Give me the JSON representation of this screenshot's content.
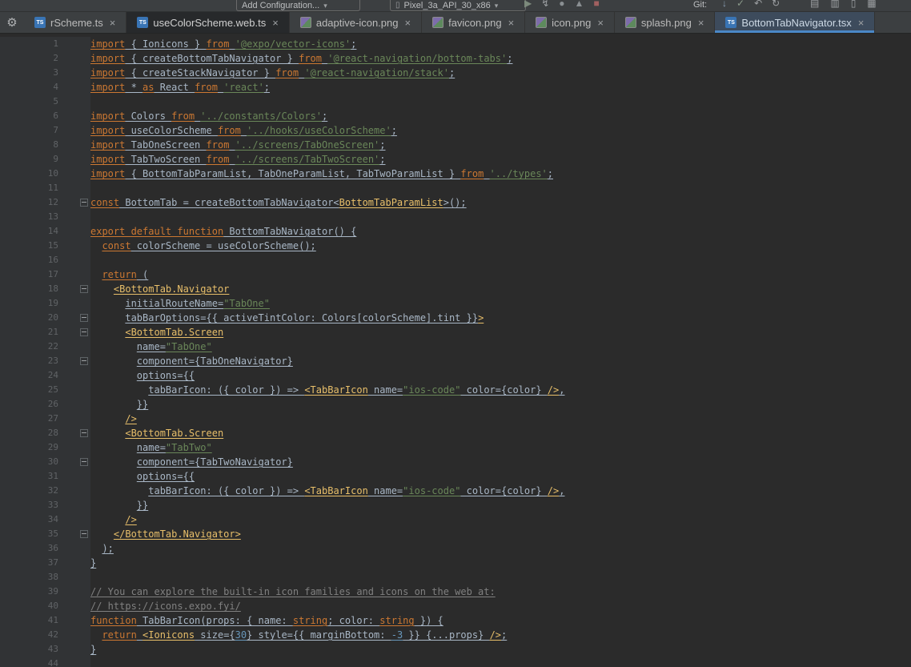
{
  "colors": {
    "editor_background": "#2b2b2b",
    "gutter_background": "#313335",
    "toolbar_background": "#3c3f41",
    "active_tab_underline": "#4a88c7",
    "keyword": "#cc7832",
    "string": "#6a8759",
    "jsx_tag": "#e8bf6a",
    "number": "#6897bb",
    "comment": "#808080",
    "plain_text": "#a9b7c6",
    "line_number": "#606366"
  },
  "toolbar": {
    "add_configuration": "Add Configuration...",
    "device": "Pixel_3a_API_30_x86",
    "git_label": "Git:",
    "caret_glyph": "▾",
    "device_icon_glyph": "▯",
    "run_icons": [
      {
        "name": "run-icon",
        "glyph": "▶",
        "color": "#7c8a7c"
      },
      {
        "name": "apply-changes-icon",
        "glyph": "↯",
        "color": "#9da0a3"
      },
      {
        "name": "debug-icon",
        "glyph": "●",
        "color": "#8a8f92"
      },
      {
        "name": "profiler-icon",
        "glyph": "▲",
        "color": "#8a8f92"
      },
      {
        "name": "stop-icon",
        "glyph": "■",
        "color": "#a06060"
      }
    ],
    "git_icons": [
      {
        "name": "update-project-icon",
        "glyph": "↓",
        "color": "#8a9fb5"
      },
      {
        "name": "commit-icon",
        "glyph": "✓",
        "color": "#8a9a8a"
      },
      {
        "name": "rollback-icon",
        "glyph": "↶",
        "color": "#9da0a3"
      },
      {
        "name": "history-icon",
        "glyph": "↻",
        "color": "#9da0a3"
      }
    ],
    "right_icons": [
      {
        "name": "device-manager-icon",
        "glyph": "▤",
        "color": "#9da0a3"
      },
      {
        "name": "logcat-icon",
        "glyph": "▥",
        "color": "#9da0a3"
      },
      {
        "name": "emulator-icon",
        "glyph": "▯",
        "color": "#9da0a3"
      },
      {
        "name": "sdk-manager-icon",
        "glyph": "▦",
        "color": "#9da0a3"
      }
    ]
  },
  "tabbar": {
    "gear_glyph": "⚙"
  },
  "tabs": {
    "close_glyph": "×",
    "items": [
      {
        "label": "rScheme.ts",
        "type": "ts",
        "state": ""
      },
      {
        "label": "useColorScheme.web.ts",
        "type": "ts",
        "state": "current-dark"
      },
      {
        "label": "adaptive-icon.png",
        "type": "png",
        "state": ""
      },
      {
        "label": "favicon.png",
        "type": "png",
        "state": ""
      },
      {
        "label": "icon.png",
        "type": "png",
        "state": ""
      },
      {
        "label": "splash.png",
        "type": "png",
        "state": ""
      },
      {
        "label": "BottomTabNavigator.tsx",
        "type": "tsx",
        "state": "active"
      }
    ]
  },
  "editor": {
    "fold_lines": [
      12,
      18,
      20,
      21,
      23,
      28,
      30,
      35
    ],
    "lines": [
      [
        [
          "k",
          "import"
        ],
        [
          "p",
          " { Ionicons } "
        ],
        [
          "k",
          "from"
        ],
        [
          "p",
          " "
        ],
        [
          "s",
          "'@expo/vector-icons'"
        ],
        [
          "p",
          ";"
        ]
      ],
      [
        [
          "k",
          "import"
        ],
        [
          "p",
          " { createBottomTabNavigator } "
        ],
        [
          "k",
          "from"
        ],
        [
          "p",
          " "
        ],
        [
          "s",
          "'@react-navigation/bottom-tabs'"
        ],
        [
          "p",
          ";"
        ]
      ],
      [
        [
          "k",
          "import"
        ],
        [
          "p",
          " { createStackNavigator } "
        ],
        [
          "k",
          "from"
        ],
        [
          "p",
          " "
        ],
        [
          "s",
          "'@react-navigation/stack'"
        ],
        [
          "p",
          ";"
        ]
      ],
      [
        [
          "k",
          "import"
        ],
        [
          "p",
          " * "
        ],
        [
          "k",
          "as"
        ],
        [
          "p",
          " React "
        ],
        [
          "k",
          "from"
        ],
        [
          "p",
          " "
        ],
        [
          "s",
          "'react'"
        ],
        [
          "p",
          ";"
        ]
      ],
      [],
      [
        [
          "k",
          "import"
        ],
        [
          "p",
          " Colors "
        ],
        [
          "k",
          "from"
        ],
        [
          "p",
          " "
        ],
        [
          "s",
          "'../constants/Colors'"
        ],
        [
          "p",
          ";"
        ]
      ],
      [
        [
          "k",
          "import"
        ],
        [
          "p",
          " useColorScheme "
        ],
        [
          "k",
          "from"
        ],
        [
          "p",
          " "
        ],
        [
          "s",
          "'../hooks/useColorScheme'"
        ],
        [
          "p",
          ";"
        ]
      ],
      [
        [
          "k",
          "import"
        ],
        [
          "p",
          " TabOneScreen "
        ],
        [
          "k",
          "from"
        ],
        [
          "p",
          " "
        ],
        [
          "s",
          "'../screens/TabOneScreen'"
        ],
        [
          "p",
          ";"
        ]
      ],
      [
        [
          "k",
          "import"
        ],
        [
          "p",
          " TabTwoScreen "
        ],
        [
          "k",
          "from"
        ],
        [
          "p",
          " "
        ],
        [
          "s",
          "'../screens/TabTwoScreen'"
        ],
        [
          "p",
          ";"
        ]
      ],
      [
        [
          "k",
          "import"
        ],
        [
          "p",
          " { BottomTabParamList, TabOneParamList, TabTwoParamList } "
        ],
        [
          "k",
          "from"
        ],
        [
          "p",
          " "
        ],
        [
          "s",
          "'../types'"
        ],
        [
          "p",
          ";"
        ]
      ],
      [],
      [
        [
          "k",
          "const"
        ],
        [
          "p",
          " BottomTab = createBottomTabNavigator<"
        ],
        [
          "t",
          "BottomTabParamList"
        ],
        [
          "p",
          ">();"
        ]
      ],
      [],
      [
        [
          "k",
          "export default function"
        ],
        [
          "p",
          " BottomTabNavigator() {"
        ]
      ],
      [
        [
          "w",
          "  "
        ],
        [
          "k",
          "const"
        ],
        [
          "p",
          " colorScheme = useColorScheme();"
        ]
      ],
      [],
      [
        [
          "w",
          "  "
        ],
        [
          "k",
          "return"
        ],
        [
          "p",
          " ("
        ]
      ],
      [
        [
          "w",
          "    "
        ],
        [
          "t",
          "<BottomTab.Navigator"
        ]
      ],
      [
        [
          "w",
          "      "
        ],
        [
          "p",
          "initialRouteName="
        ],
        [
          "s",
          "\"TabOne\""
        ]
      ],
      [
        [
          "w",
          "      "
        ],
        [
          "p",
          "tabBarOptions={{ activeTintColor: Colors[colorScheme].tint }}"
        ],
        [
          "t",
          ">"
        ]
      ],
      [
        [
          "w",
          "      "
        ],
        [
          "t",
          "<BottomTab.Screen"
        ]
      ],
      [
        [
          "w",
          "        "
        ],
        [
          "p",
          "name="
        ],
        [
          "s",
          "\"TabOne\""
        ]
      ],
      [
        [
          "w",
          "        "
        ],
        [
          "p",
          "component={TabOneNavigator}"
        ]
      ],
      [
        [
          "w",
          "        "
        ],
        [
          "p",
          "options={{"
        ]
      ],
      [
        [
          "w",
          "          "
        ],
        [
          "p",
          "tabBarIcon: ({ color }) => "
        ],
        [
          "t",
          "<TabBarIcon"
        ],
        [
          "p",
          " name="
        ],
        [
          "s",
          "\"ios-code\""
        ],
        [
          "p",
          " color={color} "
        ],
        [
          "t",
          "/>"
        ],
        [
          "p",
          ","
        ]
      ],
      [
        [
          "w",
          "        "
        ],
        [
          "p",
          "}}"
        ]
      ],
      [
        [
          "w",
          "      "
        ],
        [
          "t",
          "/>"
        ]
      ],
      [
        [
          "w",
          "      "
        ],
        [
          "t",
          "<BottomTab.Screen"
        ]
      ],
      [
        [
          "w",
          "        "
        ],
        [
          "p",
          "name="
        ],
        [
          "s",
          "\"TabTwo\""
        ]
      ],
      [
        [
          "w",
          "        "
        ],
        [
          "p",
          "component={TabTwoNavigator}"
        ]
      ],
      [
        [
          "w",
          "        "
        ],
        [
          "p",
          "options={{"
        ]
      ],
      [
        [
          "w",
          "          "
        ],
        [
          "p",
          "tabBarIcon: ({ color }) => "
        ],
        [
          "t",
          "<TabBarIcon"
        ],
        [
          "p",
          " name="
        ],
        [
          "s",
          "\"ios-code\""
        ],
        [
          "p",
          " color={color} "
        ],
        [
          "t",
          "/>"
        ],
        [
          "p",
          ","
        ]
      ],
      [
        [
          "w",
          "        "
        ],
        [
          "p",
          "}}"
        ]
      ],
      [
        [
          "w",
          "      "
        ],
        [
          "t",
          "/>"
        ]
      ],
      [
        [
          "w",
          "    "
        ],
        [
          "t",
          "</BottomTab.Navigator>"
        ]
      ],
      [
        [
          "w",
          "  "
        ],
        [
          "p",
          ");"
        ]
      ],
      [
        [
          "p",
          "}"
        ]
      ],
      [],
      [
        [
          "c",
          "// You can explore the built-in icon families and icons on the web at:"
        ]
      ],
      [
        [
          "c",
          "// https://icons.expo.fyi/"
        ]
      ],
      [
        [
          "k",
          "function"
        ],
        [
          "p",
          " TabBarIcon(props: { name: "
        ],
        [
          "k",
          "string"
        ],
        [
          "p",
          "; color: "
        ],
        [
          "k",
          "string"
        ],
        [
          "p",
          " }) {"
        ]
      ],
      [
        [
          "w",
          "  "
        ],
        [
          "k",
          "return"
        ],
        [
          "p",
          " "
        ],
        [
          "t",
          "<Ionicons"
        ],
        [
          "p",
          " size={"
        ],
        [
          "n",
          "30"
        ],
        [
          "p",
          "} style={{ marginBottom: "
        ],
        [
          "n",
          "-3"
        ],
        [
          "p",
          " }} {...props} "
        ],
        [
          "t",
          "/>"
        ],
        [
          "p",
          ";"
        ]
      ],
      [
        [
          "p",
          "}"
        ]
      ],
      []
    ]
  }
}
